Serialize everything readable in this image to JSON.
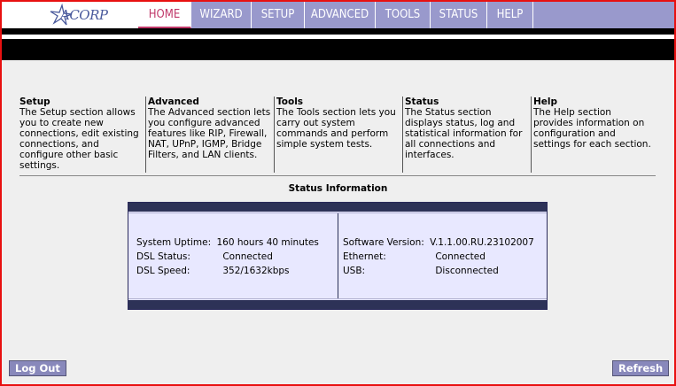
{
  "logo": {
    "text": "ACORP"
  },
  "nav": {
    "tabs": [
      {
        "label": "HOME"
      },
      {
        "label": "WIZARD"
      },
      {
        "label": "SETUP"
      },
      {
        "label": "ADVANCED"
      },
      {
        "label": "TOOLS"
      },
      {
        "label": "STATUS"
      },
      {
        "label": "HELP"
      }
    ]
  },
  "sections": [
    {
      "title": "Setup",
      "text": "The Setup section allows you to create new connections, edit existing connections, and configure other basic settings."
    },
    {
      "title": "Advanced",
      "text": "The Advanced section lets you configure advanced features like RIP, Firewall, NAT, UPnP, IGMP, Bridge Filters, and LAN clients."
    },
    {
      "title": "Tools",
      "text": "The Tools section lets you carry out system commands and perform simple system tests."
    },
    {
      "title": "Status",
      "text": "The Status section displays status, log and statistical information for all connections and interfaces."
    },
    {
      "title": "Help",
      "text": "The Help section provides information on configuration and settings for each section."
    }
  ],
  "status_info": {
    "title": "Status Information",
    "left": [
      {
        "label": "System Uptime:",
        "value": "160 hours 40 minutes"
      },
      {
        "label": "DSL Status:",
        "value": "Connected"
      },
      {
        "label": "DSL Speed:",
        "value": "352/1632kbps"
      }
    ],
    "right": [
      {
        "label": "Software Version:",
        "value": "V.1.1.00.RU.23102007"
      },
      {
        "label": "Ethernet:",
        "value": "Connected"
      },
      {
        "label": "USB:",
        "value": "Disconnected"
      }
    ]
  },
  "buttons": {
    "logout": "Log Out",
    "refresh": "Refresh"
  }
}
